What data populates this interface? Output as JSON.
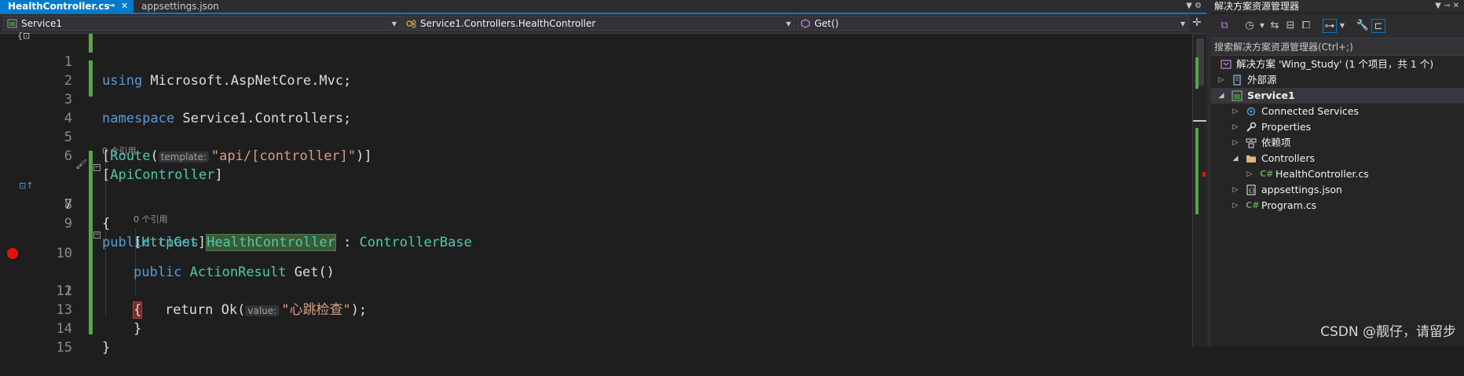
{
  "editor": {
    "tabs": [
      {
        "label": "HealthController.cs",
        "active": true
      },
      {
        "label": "appsettings.json",
        "active": false
      }
    ],
    "nav": {
      "project": "Service1",
      "class": "Service1.Controllers.HealthController",
      "member": "Get()"
    },
    "lines": [
      {
        "n": "1"
      },
      {
        "n": "2"
      },
      {
        "n": "3"
      },
      {
        "n": "4"
      },
      {
        "n": "5"
      },
      {
        "n": "6"
      },
      {
        "n": "7"
      },
      {
        "n": "8"
      },
      {
        "n": "9"
      },
      {
        "n": "10"
      },
      {
        "n": "11"
      },
      {
        "n": "12"
      },
      {
        "n": "13"
      },
      {
        "n": "14"
      },
      {
        "n": "15"
      }
    ],
    "code": {
      "l1_kw": "using",
      "l1_rest": " Microsoft.AspNetCore.Mvc;",
      "l3_kw": "namespace",
      "l3_rest": " Service1.Controllers;",
      "l5_open": "[",
      "l5_attr": "Route",
      "l5_paren": "(",
      "l5_hint": "template:",
      "l5_str": "\"api/[controller]\"",
      "l5_close": ")]",
      "l6_open": "[",
      "l6_attr": "ApiController",
      "l6_close": "]",
      "lens_class": "0 个引用",
      "l7_kw1": "public",
      "l7_kw2": " class ",
      "l7_name": "HealthController",
      "l7_colon": " : ",
      "l7_base": "ControllerBase",
      "l8_brace": "{",
      "l9_open": "[",
      "l9_attr": "HttpGet",
      "l9_close": "]",
      "lens_method": "0 个引用",
      "l10_kw": "public",
      "l10_sp": " ",
      "l10_type": "ActionResult",
      "l10_rest": " Get()",
      "l11_brace": "{",
      "l12_kw": "return",
      "l12_fn": " Ok(",
      "l12_hint": "value:",
      "l12_str": "\"心跳检查\"",
      "l12_end": ");",
      "l13_brace": "}",
      "l14_brace": "}"
    },
    "top_left_glyph": "{⊡"
  },
  "solution_explorer": {
    "title": "解决方案资源管理器",
    "search_placeholder": "搜索解决方案资源管理器(Ctrl+;)",
    "tree": [
      {
        "label": "解决方案 'Wing_Study' (1 个项目，共 1 个)",
        "icon": "solution-icon"
      },
      {
        "label": "外部源",
        "icon": "external-sources-icon"
      },
      {
        "label": "Service1",
        "icon": "csharp-project-icon"
      },
      {
        "label": "Connected Services",
        "icon": "connected-services-icon"
      },
      {
        "label": "Properties",
        "icon": "wrench-icon"
      },
      {
        "label": "依赖项",
        "icon": "dependencies-icon"
      },
      {
        "label": "Controllers",
        "icon": "folder-icon"
      },
      {
        "label": "HealthController.cs",
        "icon": "csharp-file-icon"
      },
      {
        "label": "appsettings.json",
        "icon": "json-file-icon"
      },
      {
        "label": "Program.cs",
        "icon": "csharp-file-icon"
      }
    ],
    "cs_badge": "C#"
  },
  "watermark": "CSDN @靓仔，请留步",
  "colors": {
    "accent": "#007acc",
    "keyword": "#569cd6",
    "type": "#4ec9b0",
    "string": "#d69d85",
    "change_bar": "#57a64a",
    "breakpoint": "#e51400"
  }
}
